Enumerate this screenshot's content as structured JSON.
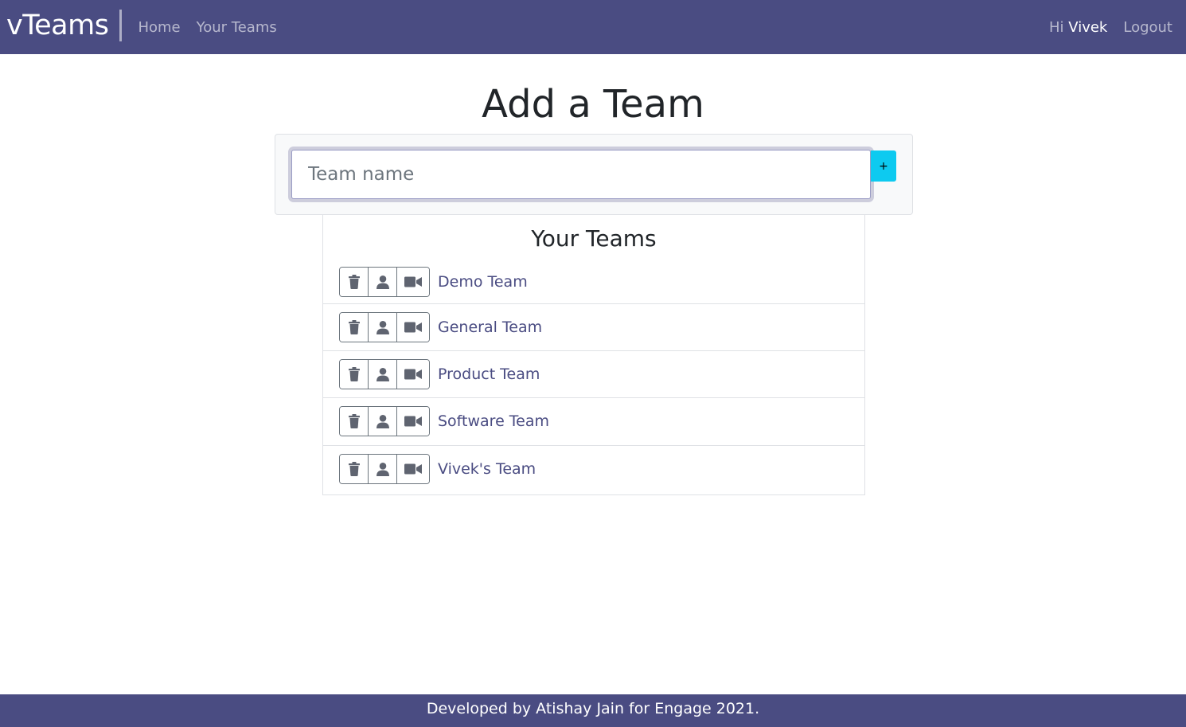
{
  "nav": {
    "brand": "vTeams",
    "links": [
      "Home",
      "Your Teams"
    ],
    "greeting": "Hi",
    "username": "Vivek",
    "logout": "Logout"
  },
  "add_team": {
    "title": "Add a Team",
    "input_placeholder": "Team name",
    "input_value": "",
    "add_button_label": "+"
  },
  "teams": {
    "heading": "Your Teams",
    "items": [
      {
        "name": "Demo Team"
      },
      {
        "name": "General Team"
      },
      {
        "name": "Product Team"
      },
      {
        "name": "Software Team"
      },
      {
        "name": "Vivek's Team"
      }
    ],
    "row_icons": [
      "trash-icon",
      "person-icon",
      "video-camera-icon"
    ]
  },
  "footer": {
    "text": "Developed by Atishay Jain for Engage 2021."
  },
  "colors": {
    "nav_bg": "#4a4c82",
    "accent_button": "#0dcaf0",
    "team_link": "#4a4c82",
    "icon": "#5f6470"
  }
}
